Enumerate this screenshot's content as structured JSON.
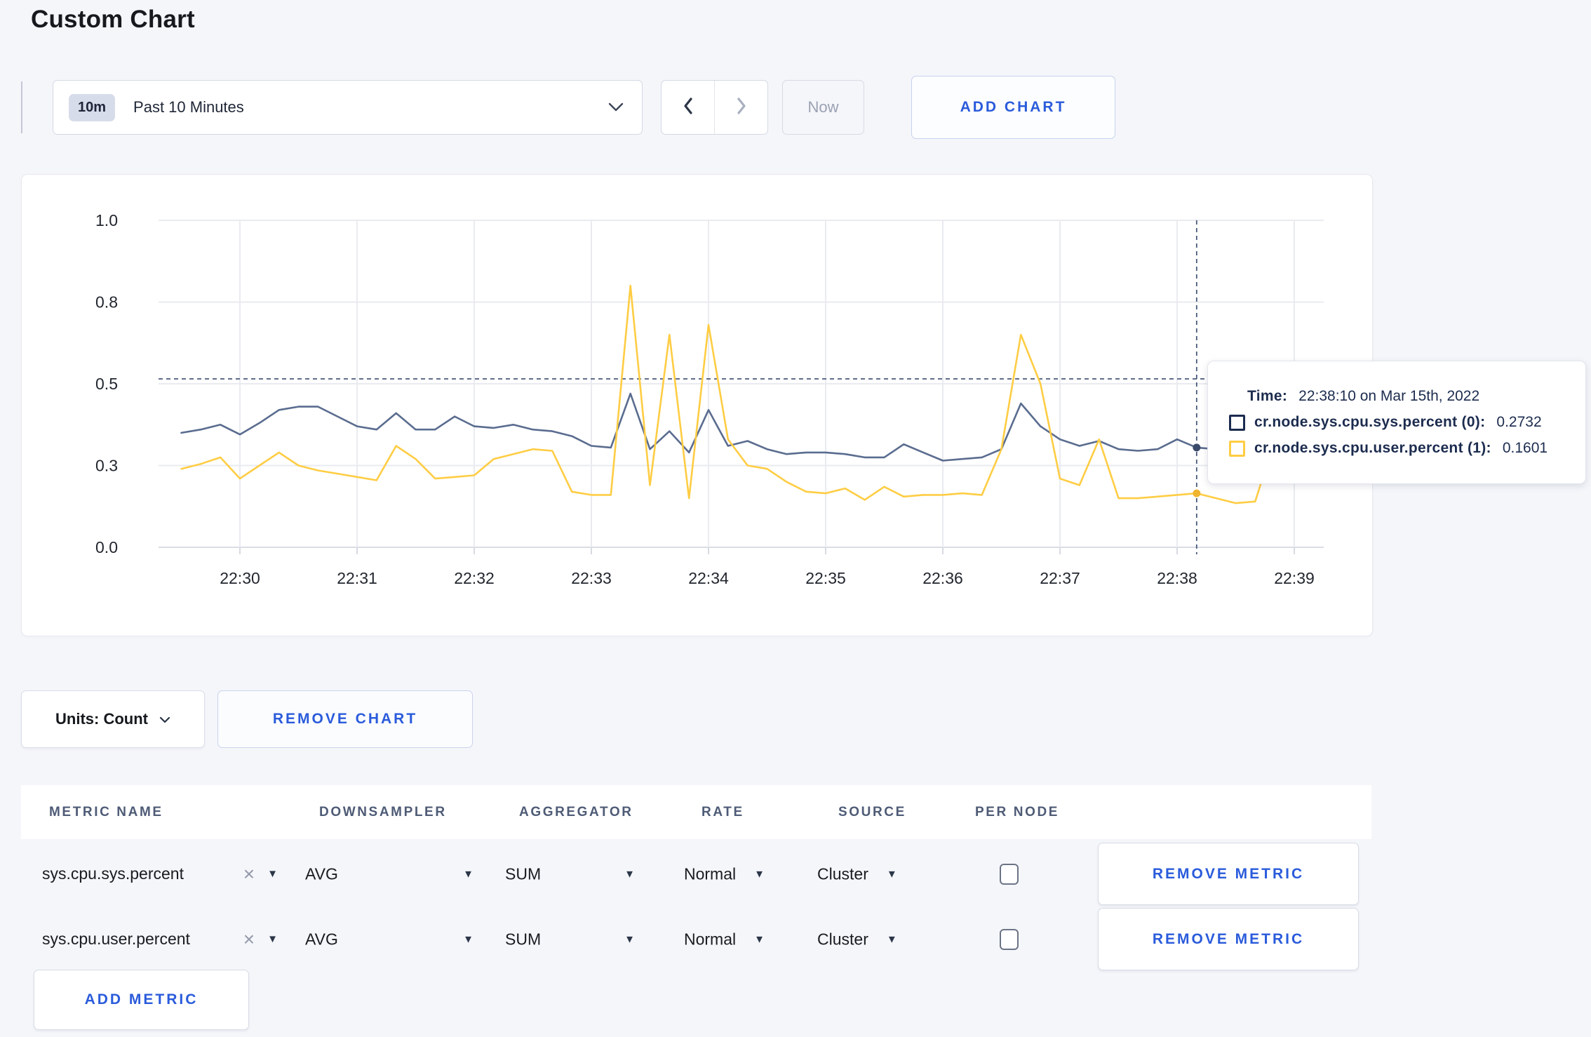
{
  "page_title": "Custom Chart",
  "toolbar": {
    "range_badge": "10m",
    "range_label": "Past 10 Minutes",
    "now_label": "Now",
    "add_chart_label": "ADD CHART"
  },
  "chart_data": {
    "type": "line",
    "title": "",
    "xlabel": "",
    "ylabel": "",
    "x_axis": {
      "tick_labels": [
        "22:30",
        "22:31",
        "22:32",
        "22:33",
        "22:34",
        "22:35",
        "22:36",
        "22:37",
        "22:38",
        "22:39"
      ],
      "tick_minutes": [
        0,
        1,
        2,
        3,
        4,
        5,
        6,
        7,
        8,
        9
      ]
    },
    "y_axis": {
      "tick_labels": [
        "0.0",
        "0.3",
        "0.5",
        "0.8",
        "1.0"
      ],
      "tick_values": [
        0,
        0.25,
        0.5,
        0.75,
        1.0
      ],
      "ylim": [
        0,
        1
      ]
    },
    "grid": true,
    "legend": "none",
    "t_start_min": -0.5,
    "t_step_min": 0.166667,
    "series": [
      {
        "name": "cr.node.sys.cpu.sys.percent",
        "color": "#5a6c8f",
        "dot_color": "#3a4a6a",
        "values": [
          0.35,
          0.36,
          0.375,
          0.345,
          0.38,
          0.42,
          0.43,
          0.43,
          0.4,
          0.37,
          0.36,
          0.41,
          0.36,
          0.36,
          0.4,
          0.37,
          0.365,
          0.375,
          0.36,
          0.355,
          0.34,
          0.31,
          0.305,
          0.47,
          0.3,
          0.355,
          0.29,
          0.42,
          0.31,
          0.325,
          0.3,
          0.285,
          0.29,
          0.29,
          0.285,
          0.275,
          0.275,
          0.315,
          0.29,
          0.265,
          0.27,
          0.275,
          0.3,
          0.44,
          0.37,
          0.33,
          0.31,
          0.325,
          0.3,
          0.295,
          0.3,
          0.33,
          0.305,
          0.3,
          0.295,
          0.3,
          0.3,
          0.31,
          0.3
        ]
      },
      {
        "name": "cr.node.sys.cpu.user.percent",
        "color": "#ffcd44",
        "dot_color": "#f0b42f",
        "values": [
          0.24,
          0.255,
          0.275,
          0.21,
          0.25,
          0.29,
          0.25,
          0.235,
          0.225,
          0.215,
          0.205,
          0.31,
          0.27,
          0.21,
          0.215,
          0.22,
          0.27,
          0.285,
          0.3,
          0.295,
          0.17,
          0.16,
          0.16,
          0.8,
          0.19,
          0.65,
          0.15,
          0.68,
          0.33,
          0.25,
          0.24,
          0.2,
          0.17,
          0.165,
          0.18,
          0.145,
          0.185,
          0.155,
          0.16,
          0.16,
          0.165,
          0.16,
          0.3,
          0.65,
          0.5,
          0.21,
          0.19,
          0.33,
          0.15,
          0.15,
          0.155,
          0.16,
          0.165,
          0.15,
          0.135,
          0.14,
          0.33,
          0.28,
          0.25
        ]
      }
    ],
    "crosshair": {
      "time_min": 8.166667,
      "cursor_value": 0.515,
      "dot_values": [
        0.305,
        0.165
      ]
    },
    "tooltip": {
      "time_label": "Time:",
      "time_value": "22:38:10 on Mar 15th, 2022",
      "rows": [
        {
          "label": "cr.node.sys.cpu.sys.percent (0):",
          "value": "0.2732",
          "color": "#1c2c4f"
        },
        {
          "label": "cr.node.sys.cpu.user.percent (1):",
          "value": "0.1601",
          "color": "#ffcd44"
        }
      ]
    }
  },
  "units_row": {
    "units_label": "Units: Count",
    "remove_chart_label": "REMOVE CHART"
  },
  "metrics": {
    "headers": [
      "METRIC NAME",
      "DOWNSAMPLER",
      "AGGREGATOR",
      "RATE",
      "SOURCE",
      "PER NODE"
    ],
    "rows": [
      {
        "name": "sys.cpu.sys.percent",
        "downsampler": "AVG",
        "aggregator": "SUM",
        "rate": "Normal",
        "source": "Cluster",
        "per_node_checked": false,
        "remove_label": "REMOVE METRIC"
      },
      {
        "name": "sys.cpu.user.percent",
        "downsampler": "AVG",
        "aggregator": "SUM",
        "rate": "Normal",
        "source": "Cluster",
        "per_node_checked": false,
        "remove_label": "REMOVE METRIC"
      }
    ],
    "add_metric_label": "ADD METRIC"
  },
  "colors": {
    "accent_blue": "#2a5bdb",
    "navy_text": "#1c2c4f",
    "page_bg": "#f5f6fa",
    "grid": "#e9ebf0"
  }
}
